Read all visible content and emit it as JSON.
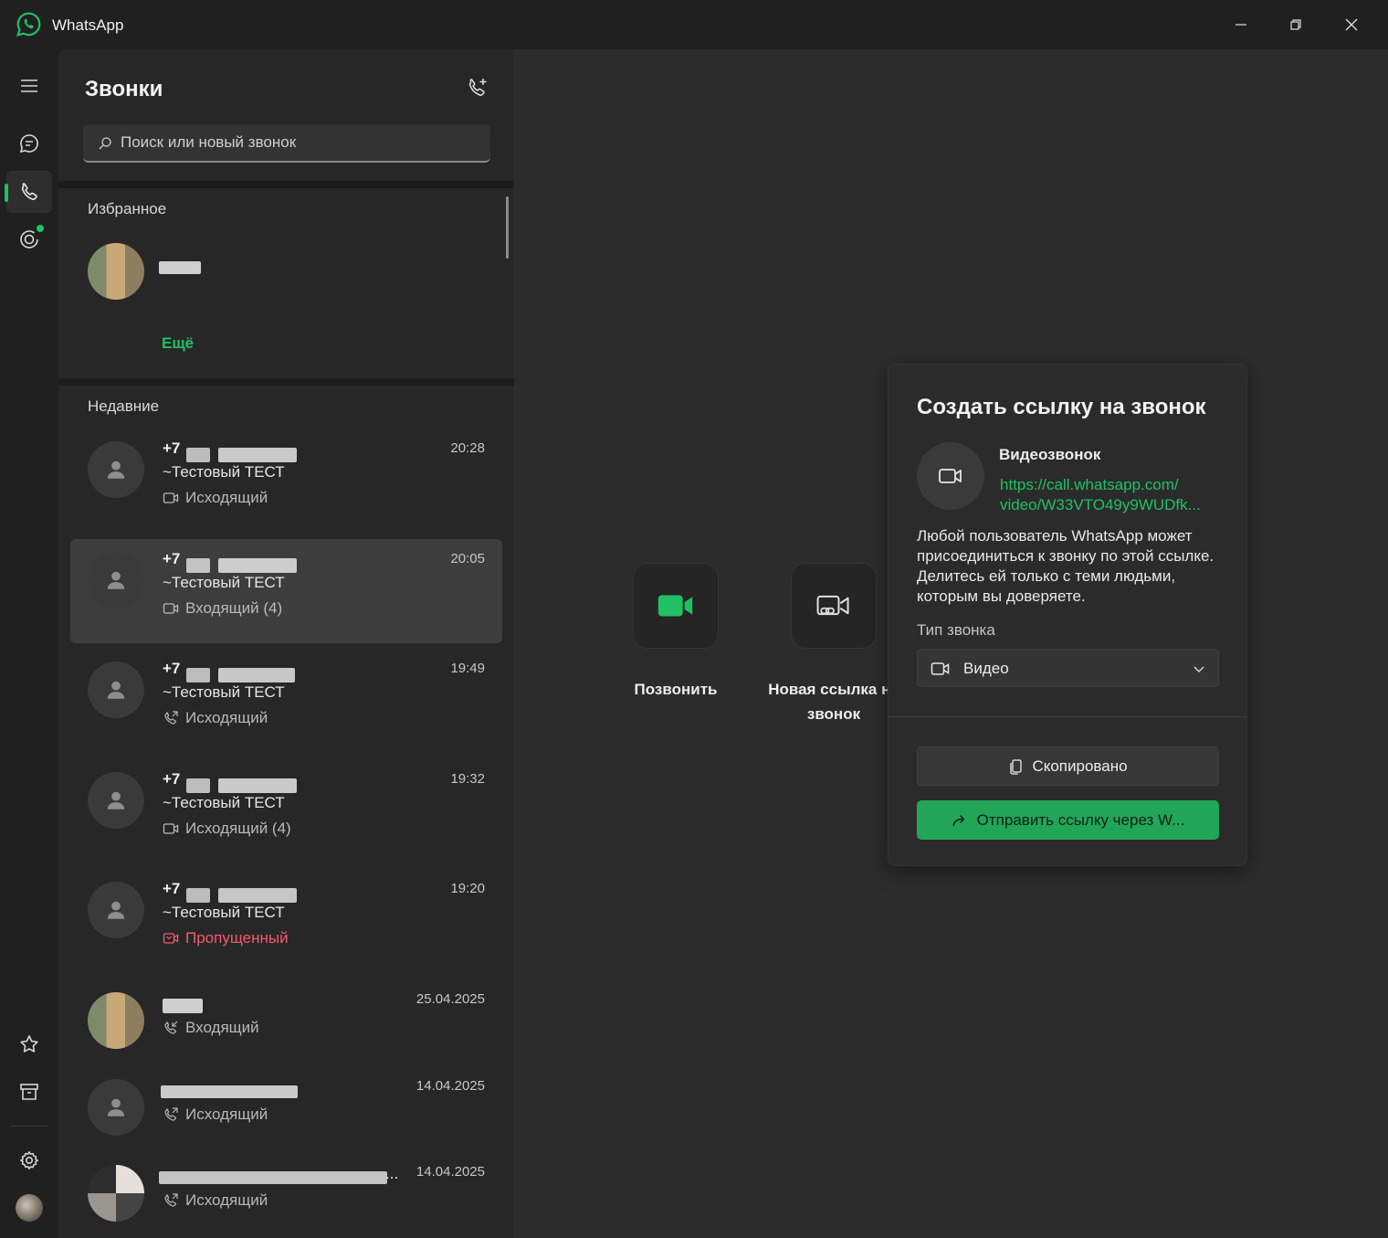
{
  "window": {
    "title": "WhatsApp",
    "controls": [
      "minimize",
      "maximize",
      "close"
    ]
  },
  "rail": {
    "items": [
      {
        "name": "menu",
        "icon": "hamburger-icon"
      },
      {
        "name": "chats",
        "icon": "chat-icon"
      },
      {
        "name": "calls",
        "icon": "phone-icon",
        "active": true
      },
      {
        "name": "status",
        "icon": "status-icon",
        "has_dot": true
      },
      {
        "name": "starred",
        "icon": "star-icon"
      },
      {
        "name": "archive",
        "icon": "archive-icon"
      },
      {
        "name": "settings",
        "icon": "gear-icon"
      },
      {
        "name": "profile",
        "icon": "avatar"
      }
    ]
  },
  "calls_panel": {
    "title": "Звонки",
    "search_placeholder": "Поиск или новый звонок",
    "favorites_label": "Избранное",
    "more_label": "Ещё",
    "recent_label": "Недавние",
    "recent": [
      {
        "number": "+7",
        "name": "~Тестовый ТЕСТ",
        "type": "Исходящий",
        "time": "20:28",
        "kind": "video"
      },
      {
        "number": "+7",
        "name": "~Тестовый ТЕСТ",
        "type": "Входящий (4)",
        "time": "20:05",
        "kind": "video",
        "selected": true
      },
      {
        "number": "+7",
        "name": "~Тестовый ТЕСТ",
        "type": "Исходящий",
        "time": "19:49",
        "kind": "voice"
      },
      {
        "number": "+7",
        "name": "~Тестовый ТЕСТ",
        "type": "Исходящий (4)",
        "time": "19:32",
        "kind": "video"
      },
      {
        "number": "+7",
        "name": "~Тестовый ТЕСТ",
        "type": "Пропущенный",
        "time": "19:20",
        "kind": "video",
        "missed": true
      },
      {
        "number": "",
        "name": "",
        "type": "Входящий",
        "time": "25.04.2025",
        "kind": "voice"
      },
      {
        "number": "",
        "name": "",
        "type": "Исходящий",
        "time": "14.04.2025",
        "kind": "voice"
      },
      {
        "number": "...",
        "name": "",
        "type": "Исходящий",
        "time": "14.04.2025",
        "kind": "voice"
      }
    ]
  },
  "main": {
    "actions": [
      {
        "label": "Позвонить",
        "icon": "video-camera-icon"
      },
      {
        "label": "Новая ссылка на звонок",
        "icon": "video-link-icon"
      }
    ]
  },
  "popup": {
    "title": "Создать ссылку на звонок",
    "call_label": "Видеозвонок",
    "link": "https://call.whatsapp.com/video/W33VTO49y9WUDfk...",
    "link_line1": "https://call.whatsapp.com/",
    "link_line2": "video/W33VTO49y9WUDfk...",
    "description": "Любой пользователь WhatsApp может присоединиться к звонку по этой ссылке. Делитесь ей только с теми людьми, которым вы доверяете.",
    "type_label": "Тип звонка",
    "type_value": "Видео",
    "copy_button": "Скопировано",
    "send_button": "Отправить ссылку через W..."
  },
  "colors": {
    "accent": "#21c063",
    "missed": "#f15c6d",
    "background": "#202020"
  }
}
